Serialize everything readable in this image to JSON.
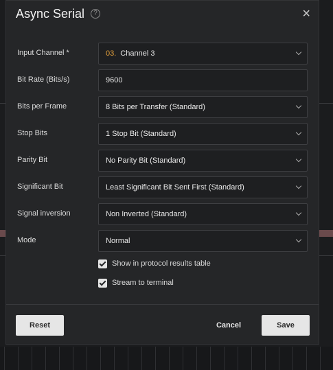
{
  "dialog": {
    "title": "Async Serial",
    "help_icon": "?",
    "close_icon": "×"
  },
  "fields": [
    {
      "label": "Input Channel *",
      "number": "03.",
      "value": "Channel 3",
      "type": "select"
    },
    {
      "label": "Bit Rate (Bits/s)",
      "value": "9600",
      "type": "input"
    },
    {
      "label": "Bits per Frame",
      "value": "8 Bits per Transfer (Standard)",
      "type": "select"
    },
    {
      "label": "Stop Bits",
      "value": "1 Stop Bit (Standard)",
      "type": "select"
    },
    {
      "label": "Parity Bit",
      "value": "No Parity Bit (Standard)",
      "type": "select"
    },
    {
      "label": "Significant Bit",
      "value": "Least Significant Bit Sent First (Standard)",
      "type": "select"
    },
    {
      "label": "Signal inversion",
      "value": "Non Inverted (Standard)",
      "type": "select"
    },
    {
      "label": "Mode",
      "value": "Normal",
      "type": "select"
    }
  ],
  "checkboxes": [
    {
      "label": "Show in protocol results table",
      "checked": true
    },
    {
      "label": "Stream to terminal",
      "checked": true
    }
  ],
  "buttons": {
    "reset": "Reset",
    "cancel": "Cancel",
    "save": "Save"
  },
  "colors": {
    "dialog_bg": "#252628",
    "field_bg": "#1e1f21",
    "channel_number": "#e6a23c",
    "button_light": "#e6e6e6"
  }
}
